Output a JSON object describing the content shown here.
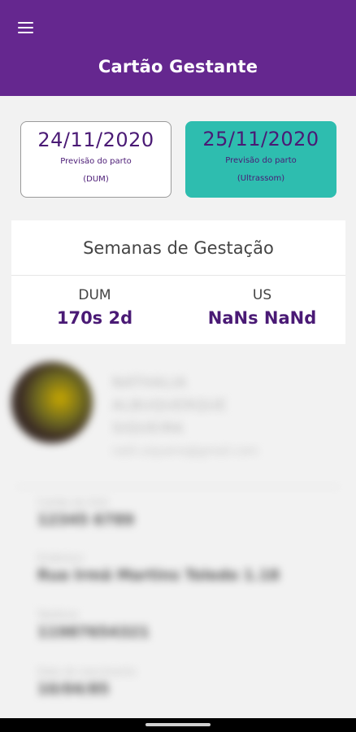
{
  "app_bar": {
    "title": "Cartão Gestante",
    "color": "#65278f"
  },
  "menu": {
    "icon": "hamburger-menu-icon"
  },
  "due_dates": {
    "dum": {
      "date": "24/11/2020",
      "label": "Previsão do parto",
      "method": "(DUM)"
    },
    "ultrasound": {
      "date": "25/11/2020",
      "label": "Previsão do parto",
      "method": "(Ultrassom)",
      "color": "#2ebdaf"
    }
  },
  "gestation": {
    "title": "Semanas de Gestação",
    "dum": {
      "label": "DUM",
      "value": "170s 2d"
    },
    "us": {
      "label": "US",
      "value": "NaNs NaNd"
    }
  },
  "profile": {
    "name_lines": [
      "NATHALIA",
      "ALBUQUERQUE",
      "SIQUEIRA"
    ],
    "email": "nath.siqueira@gmail.com",
    "fields": [
      {
        "label": "Cartão do SUS",
        "value": "12345 6789"
      },
      {
        "label": "Endereço",
        "value": "Rua Irmã Martins Toledo 1.18"
      },
      {
        "label": "Telefone",
        "value": "11987654321"
      },
      {
        "label": "Data de nascimento",
        "value": "10/04/85"
      }
    ]
  }
}
